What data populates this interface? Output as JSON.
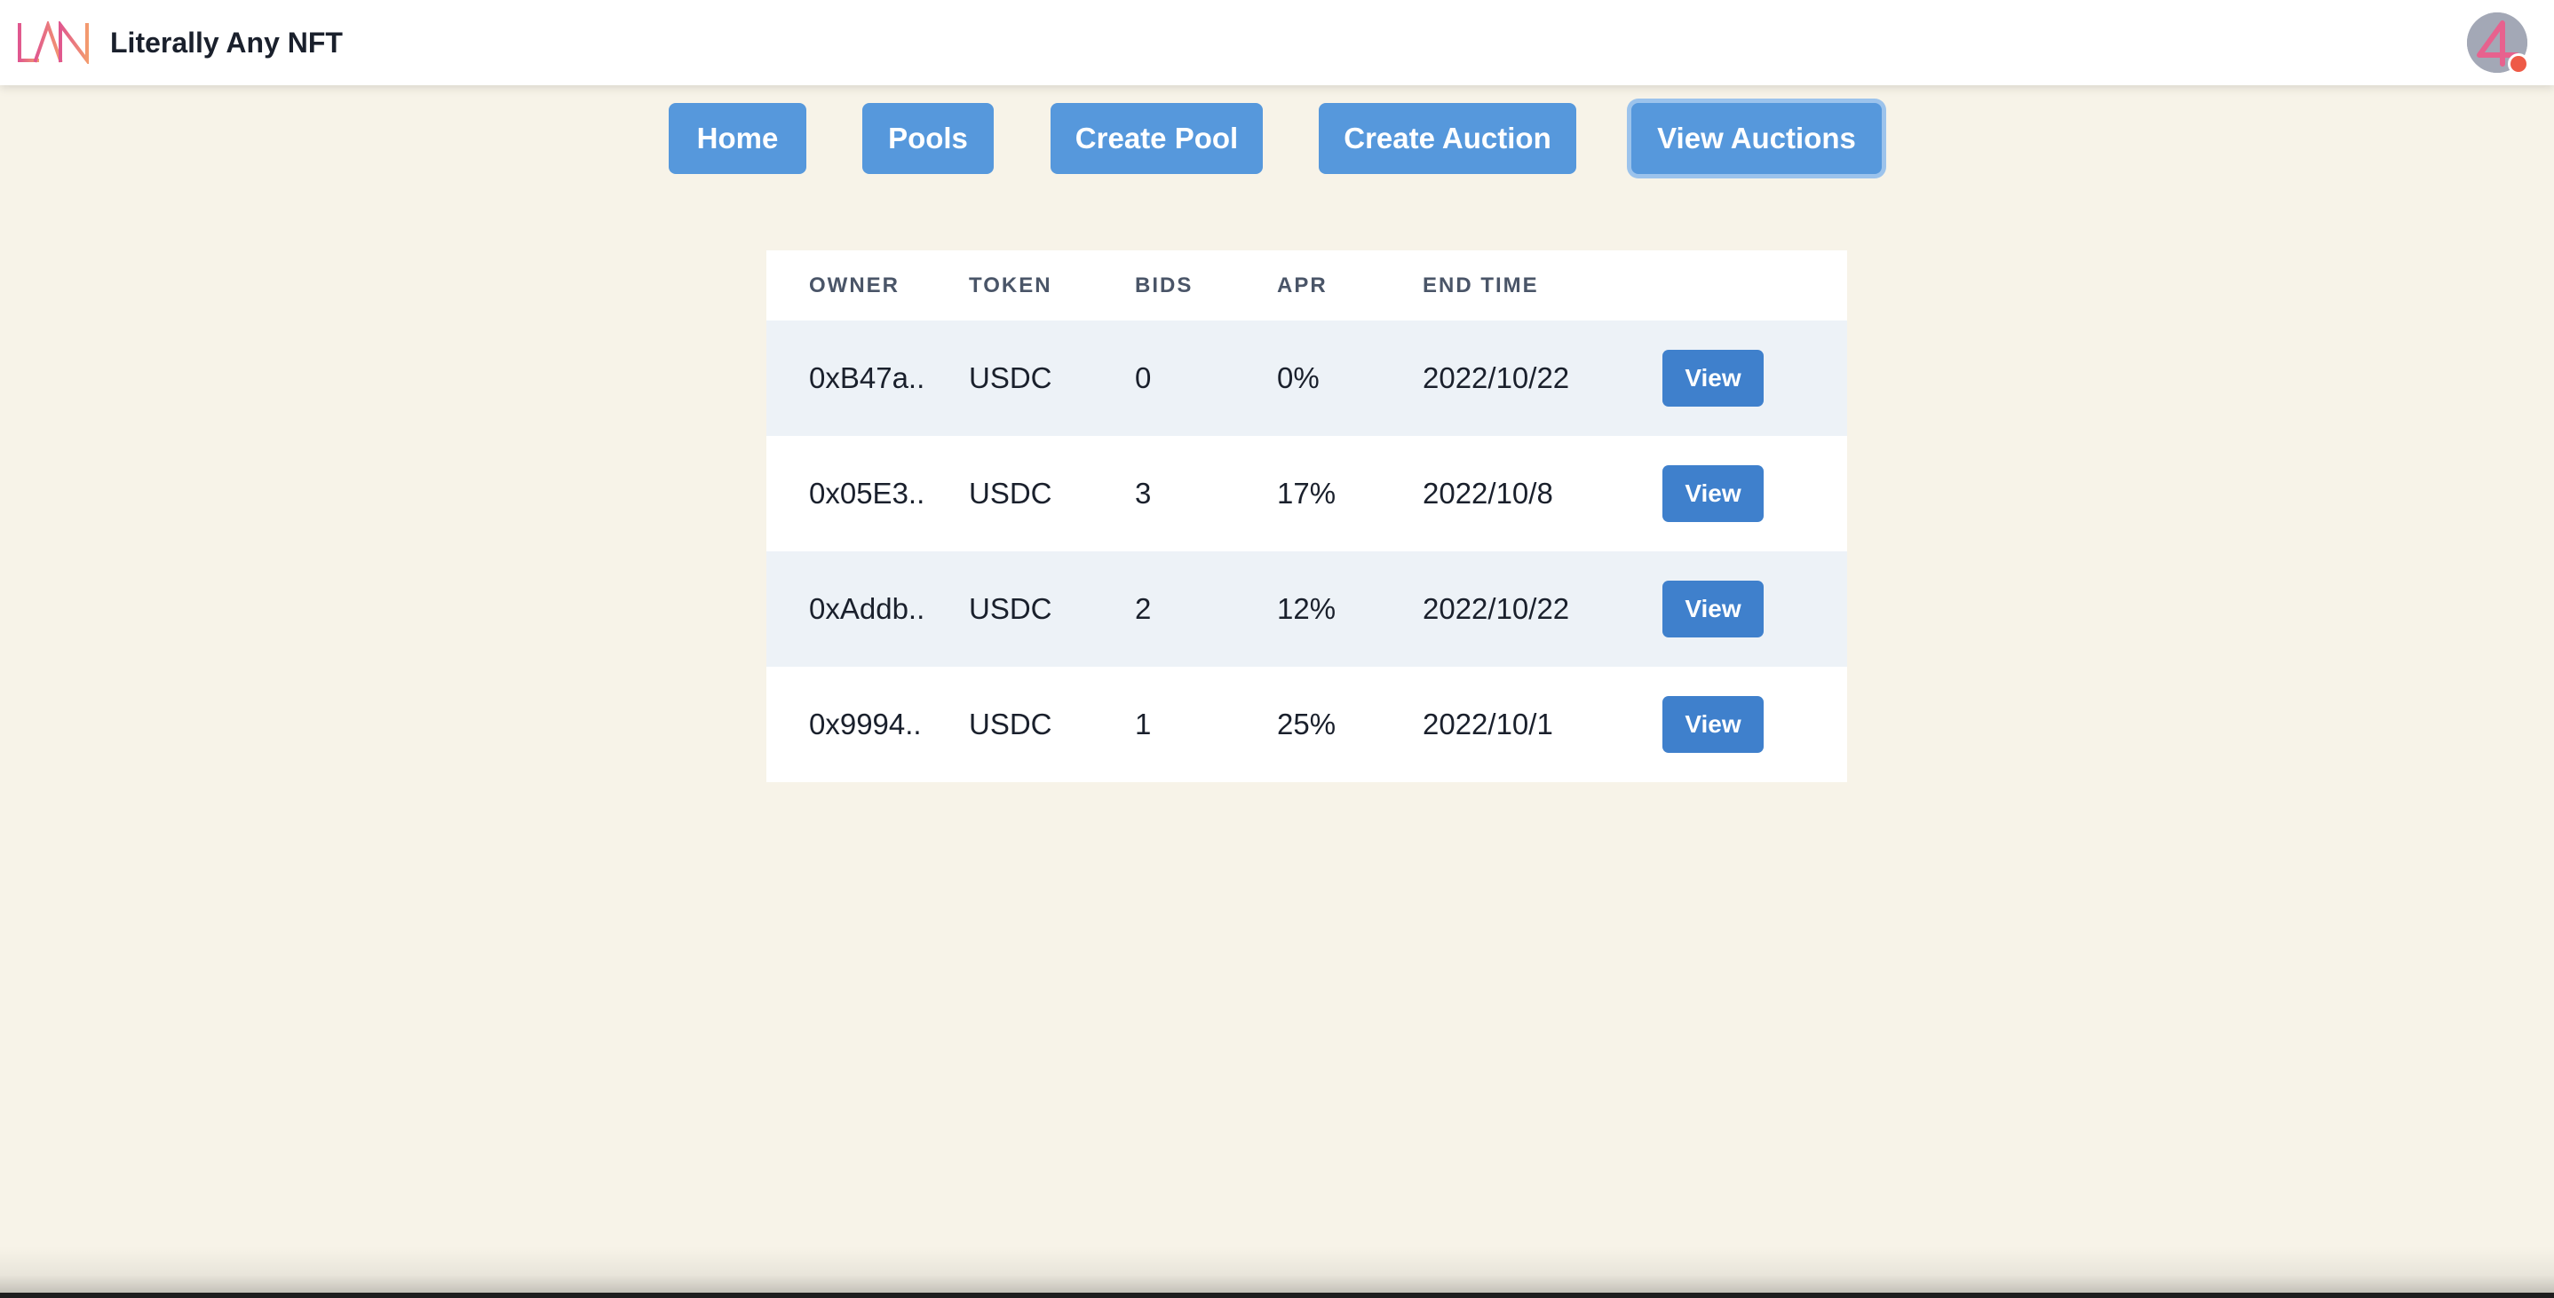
{
  "app": {
    "title": "Literally Any NFT",
    "logo_text": "LAN"
  },
  "colors": {
    "background": "#f7f3e8",
    "nav_button": "#5698dc",
    "view_button": "#3f80cc",
    "logo_gradient_start": "#e0578f",
    "logo_gradient_end": "#f39a6e",
    "avatar_dot": "#ee5a47"
  },
  "icons": {
    "logo": "lan-logo-icon",
    "avatar": "user-avatar-icon"
  },
  "nav": {
    "buttons": [
      {
        "label": "Home",
        "active": false
      },
      {
        "label": "Pools",
        "active": false
      },
      {
        "label": "Create Pool",
        "active": false
      },
      {
        "label": "Create Auction",
        "active": false
      },
      {
        "label": "View Auctions",
        "active": true
      }
    ]
  },
  "auctions_table": {
    "headers": [
      "OWNER",
      "TOKEN",
      "BIDS",
      "APR",
      "END TIME",
      ""
    ],
    "rows": [
      {
        "owner": "0xB47a..",
        "token": "USDC",
        "bids": "0",
        "apr": "0%",
        "end_time": "2022/10/22",
        "action": "View"
      },
      {
        "owner": "0x05E3..",
        "token": "USDC",
        "bids": "3",
        "apr": "17%",
        "end_time": "2022/10/8",
        "action": "View"
      },
      {
        "owner": "0xAddb..",
        "token": "USDC",
        "bids": "2",
        "apr": "12%",
        "end_time": "2022/10/22",
        "action": "View"
      },
      {
        "owner": "0x9994..",
        "token": "USDC",
        "bids": "1",
        "apr": "25%",
        "end_time": "2022/10/1",
        "action": "View"
      }
    ]
  }
}
